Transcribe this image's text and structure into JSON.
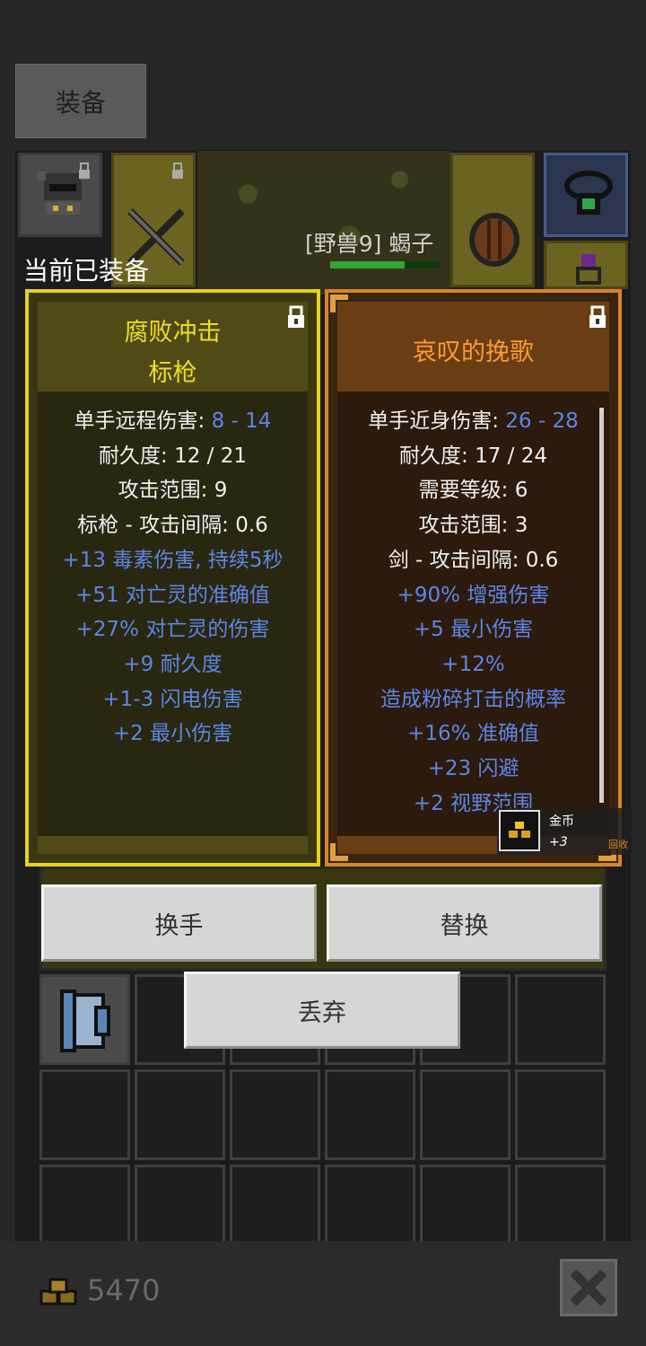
{
  "tab": {
    "label": "装备"
  },
  "enemy": {
    "label": "[野兽9] 蝎子"
  },
  "section_label": "当前已装备",
  "left_card": {
    "title_line1": "腐败冲击",
    "title_line2": "标枪",
    "stats": [
      {
        "label": "单手远程伤害: ",
        "value": "8 - 14"
      },
      {
        "label": "耐久度: 12 / 21"
      },
      {
        "label": "攻击范围: 9"
      },
      {
        "label": "标枪 - 攻击间隔: 0.6"
      },
      {
        "mod": "+13 毒素伤害, 持续5秒"
      },
      {
        "mod": "+51 对亡灵的准确值"
      },
      {
        "mod": "+27% 对亡灵的伤害"
      },
      {
        "mod": "+9 耐久度"
      },
      {
        "mod": "+1-3 闪电伤害"
      },
      {
        "mod": "+2 最小伤害"
      }
    ]
  },
  "right_card": {
    "title": "哀叹的挽歌",
    "stats": [
      {
        "label": "单手近身伤害: ",
        "value": "26 - 28"
      },
      {
        "label": "耐久度: 17 / 24"
      },
      {
        "label": "需要等级: 6"
      },
      {
        "label": "攻击范围: 3"
      },
      {
        "label": "剑 - 攻击间隔: 0.6"
      },
      {
        "mod": "+90% 增强伤害"
      },
      {
        "mod": "+5 最小伤害"
      },
      {
        "mod": "+12%"
      },
      {
        "mod": "造成粉碎打击的概率"
      },
      {
        "mod": "+16% 准确值"
      },
      {
        "mod": "+23 闪避"
      },
      {
        "mod": "+2 视野范围"
      }
    ]
  },
  "recycle": {
    "name": "金币",
    "amount": "+3",
    "action": "回收"
  },
  "buttons": {
    "swap_hand": "换手",
    "replace": "替换",
    "discard": "丢弃"
  },
  "gold": {
    "amount": "5470"
  },
  "colors": {
    "left_border": "#e6d21e",
    "right_border": "#d8842a",
    "mod_text": "#5b86e6",
    "title_yellow": "#f0dc28",
    "title_orange": "#ff9a30"
  }
}
